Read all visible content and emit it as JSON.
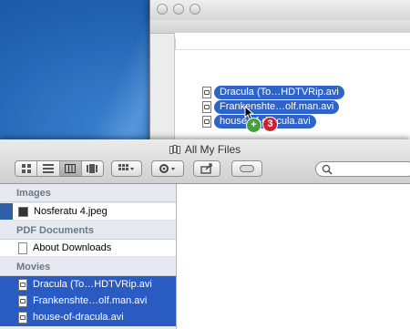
{
  "back_window": {
    "dragged_items": [
      {
        "label": "Dracula (To…HDTVRip.avi"
      },
      {
        "label": "Frankenshte…olf.man.avi"
      },
      {
        "label": "house-of-dracula.avi"
      }
    ],
    "drag_badge_plus": "+",
    "drag_badge_count": "3"
  },
  "front_window": {
    "title": "All My Files",
    "toolbar": {
      "view_buttons": [
        "icon-view",
        "list-view",
        "column-view",
        "coverflow-view"
      ],
      "active_view": "column-view",
      "arrange_icon": "grid-icon",
      "action_icon": "gear-icon",
      "share_icon": "share-icon",
      "toggle_icon": "pill-icon",
      "search_placeholder": ""
    },
    "sidebar": {
      "sections": [
        {
          "header": "Images",
          "items": [
            {
              "label": "Nosferatu 4.jpeg",
              "icon": "image-file-icon"
            }
          ]
        },
        {
          "header": "PDF Documents",
          "items": [
            {
              "label": "About Downloads",
              "icon": "pdf-file-icon"
            }
          ]
        },
        {
          "header": "Movies",
          "items": [
            {
              "label": "Dracula (To…HDTVRip.avi",
              "icon": "movie-file-icon",
              "selected": true
            },
            {
              "label": "Frankenshte…olf.man.avi",
              "icon": "movie-file-icon",
              "selected": true
            },
            {
              "label": "house-of-dracula.avi",
              "icon": "movie-file-icon",
              "selected": true
            }
          ]
        }
      ]
    }
  },
  "colors": {
    "selection": "#2a5bc2",
    "badge_red": "#d3202a",
    "badge_green": "#3fa33a"
  }
}
